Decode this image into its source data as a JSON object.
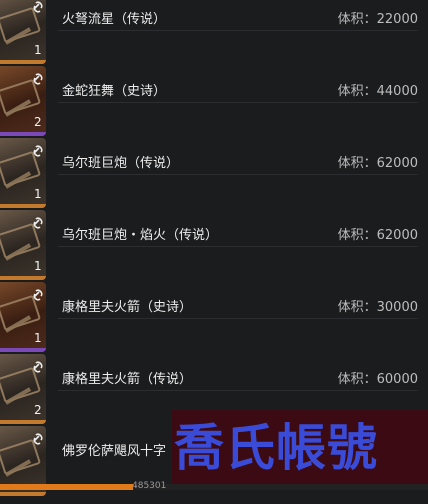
{
  "items": [
    {
      "name": "火弩流星（传说）",
      "volume": "体积：22000",
      "count": "1",
      "rarity": "legend",
      "icon": "link-icon"
    },
    {
      "name": "金蛇狂舞（史诗）",
      "volume": "体积：44000",
      "count": "2",
      "rarity": "epic",
      "icon": "link-icon"
    },
    {
      "name": "乌尔班巨炮（传说）",
      "volume": "体积：62000",
      "count": "1",
      "rarity": "legend",
      "icon": "link-icon"
    },
    {
      "name": "乌尔班巨炮・焰火（传说）",
      "volume": "体积：62000",
      "count": "1",
      "rarity": "legend",
      "icon": "link-icon"
    },
    {
      "name": "康格里夫火箭（史诗）",
      "volume": "体积：30000",
      "count": "1",
      "rarity": "epic",
      "icon": "link-icon"
    },
    {
      "name": "康格里夫火箭（传说）",
      "volume": "体积：60000",
      "count": "2",
      "rarity": "legend",
      "icon": "link-icon"
    },
    {
      "name": "佛罗伦萨飓风十字",
      "volume": "",
      "count": "",
      "rarity": "legend",
      "icon": "link-icon"
    }
  ],
  "watermark": "喬氏帳號",
  "progress": {
    "text": "485301",
    "fraction": 0.31
  },
  "colors": {
    "legend": "#c37a2c",
    "epic": "#7b4ab8",
    "accent": "#e07a1a"
  }
}
